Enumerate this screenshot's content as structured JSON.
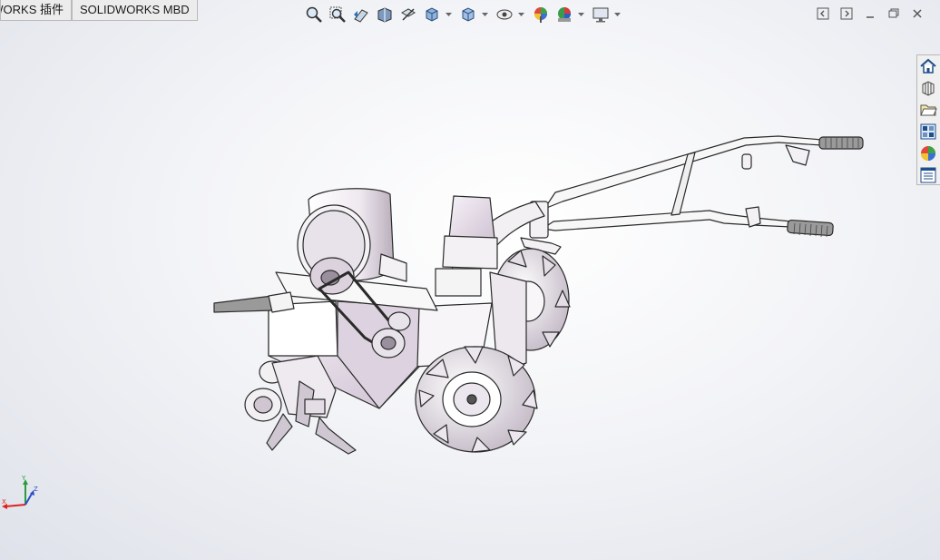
{
  "tabs": [
    {
      "label": "SOLIDWORKS 插件"
    },
    {
      "label": "SOLIDWORKS MBD"
    }
  ],
  "heads_up_toolbar": {
    "tools": [
      {
        "icon": "zoom-to-fit-icon",
        "dropdown": false
      },
      {
        "icon": "zoom-to-area-icon",
        "dropdown": false
      },
      {
        "icon": "previous-view-icon",
        "dropdown": false
      },
      {
        "icon": "section-view-icon",
        "dropdown": false
      },
      {
        "icon": "dynamic-annotation-icon",
        "dropdown": false
      },
      {
        "icon": "view-orientation-icon",
        "dropdown": true
      },
      {
        "icon": "display-style-icon",
        "dropdown": true
      },
      {
        "icon": "hide-show-items-icon",
        "dropdown": true
      },
      {
        "icon": "edit-appearance-icon",
        "dropdown": false
      },
      {
        "icon": "apply-scene-icon",
        "dropdown": true
      },
      {
        "icon": "view-settings-icon",
        "dropdown": true
      }
    ]
  },
  "window_controls": [
    "restore-left-icon",
    "restore-right-icon",
    "minimize-icon",
    "maximize-icon",
    "close-icon"
  ],
  "task_pane": [
    "home-icon",
    "design-library-icon",
    "file-explorer-icon",
    "view-palette-icon",
    "appearances-icon",
    "custom-properties-icon"
  ],
  "triad": {
    "x_label": "X",
    "y_label": "Y",
    "z_label": "Z"
  },
  "colors": {
    "viewport_bg": "#eef0f4",
    "model_stroke": "#2a2a2a",
    "model_fill": "#f2eff4"
  }
}
